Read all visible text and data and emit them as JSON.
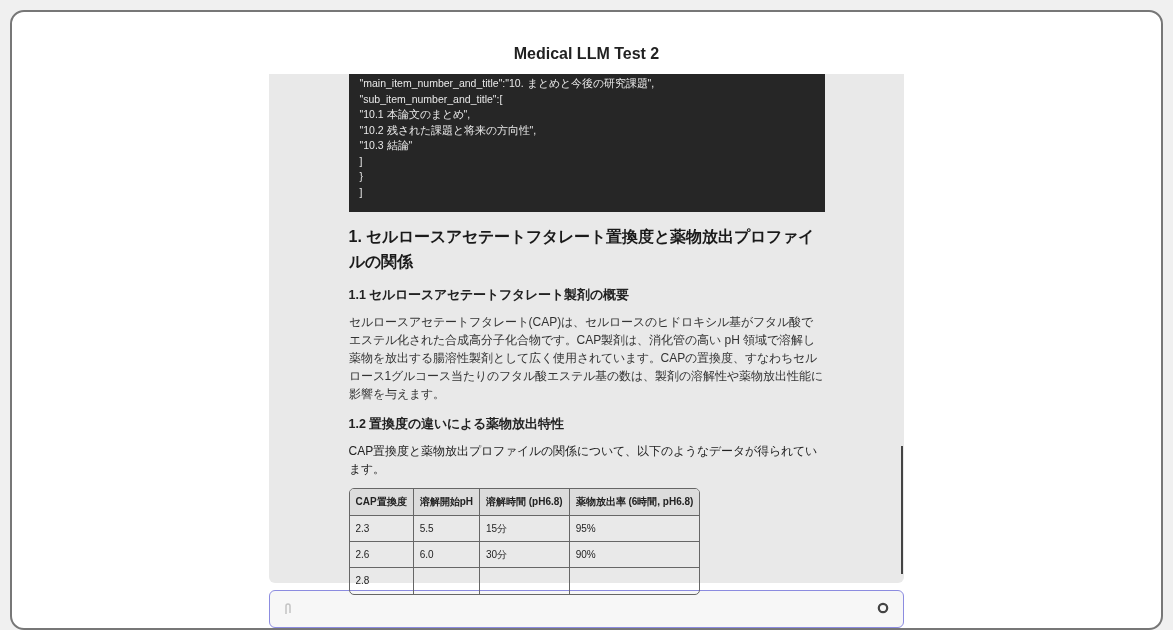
{
  "title": "Medical LLM Test 2",
  "code_lines": [
    "\"main_item_number_and_title\":\"10. まとめと今後の研究課題\",",
    "\"sub_item_number_and_title\":[",
    "\"10.1 本論文のまとめ\",",
    "\"10.2 残された課題と将来の方向性\",",
    "\"10.3 結論\"",
    "]",
    "}",
    "]"
  ],
  "heading": "1. セルロースアセテートフタレート置換度と薬物放出プロファイルの関係",
  "section_1": {
    "heading": "1.1 セルロースアセテートフタレート製剤の概要",
    "paragraph": "セルロースアセテートフタレート(CAP)は、セルロースのヒドロキシル基がフタル酸でエステル化された合成高分子化合物です。CAP製剤は、消化管の高い pH 領域で溶解し薬物を放出する腸溶性製剤として広く使用されています。CAPの置換度、すなわちセルロース1グルコース当たりのフタル酸エステル基の数は、製剤の溶解性や薬物放出性能に影響を与えます。"
  },
  "section_2": {
    "heading": "1.2 置換度の違いによる薬物放出特性",
    "paragraph": "CAP置換度と薬物放出プロファイルの関係について、以下のようなデータが得られています。"
  },
  "table": {
    "columns": [
      "CAP置換度",
      "溶解開始pH",
      "溶解時間 (pH6.8)",
      "薬物放出率 (6時間, pH6.8)"
    ],
    "rows": [
      [
        "2.3",
        "5.5",
        "15分",
        "95%"
      ],
      [
        "2.6",
        "6.0",
        "30分",
        "90%"
      ],
      [
        "2.8"
      ]
    ]
  }
}
